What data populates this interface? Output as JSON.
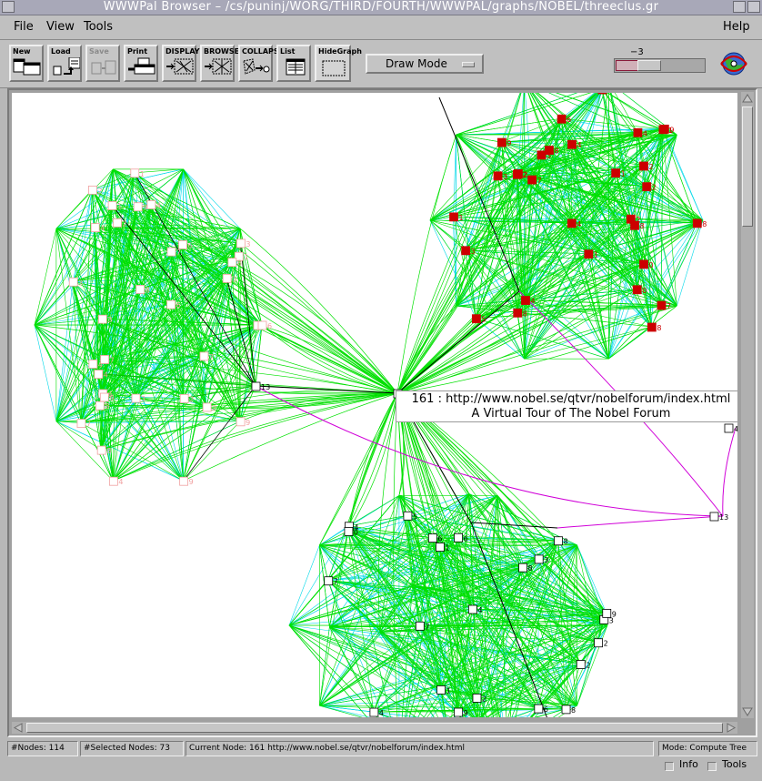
{
  "window": {
    "title": "WWWPal Browser – /cs/puninj/WORG/THIRD/FOURTH/WWWPAL/graphs/NOBEL/threeclus.gr"
  },
  "menu": {
    "file": "File",
    "view": "View",
    "tools": "Tools",
    "help": "Help"
  },
  "toolbar": {
    "new": "New",
    "load": "Load",
    "save": "Save",
    "print": "Print",
    "display": "DISPLAY",
    "browse": "BROWSE",
    "collapse": "COLLAPSE",
    "list": "List",
    "hide_graph": "HideGraph"
  },
  "mode_dropdown": {
    "value": "Draw Mode"
  },
  "zoom": {
    "value": "−3",
    "level_fraction": 0.25
  },
  "tooltip": {
    "line1": "161 : http://www.nobel.se/qtvr/nobelforum/index.html",
    "line2": "A Virtual Tour of The Nobel Forum"
  },
  "status": {
    "nodes": "#Nodes:  114",
    "selected": "#Selected Nodes:  73",
    "current": "Current Node: 161 http://www.nobel.se/qtvr/nobelforum/index.html",
    "mode": "Mode: Compute Tree"
  },
  "bottom": {
    "info": "Info",
    "tools": "Tools"
  },
  "colors": {
    "edge_green": "#00e000",
    "edge_cyan": "#00d8e8",
    "edge_magenta": "#d000d8",
    "node_red": "#cc0000",
    "node_pink": "#f0a0a0",
    "node_white": "#ffffff"
  },
  "graph_labels": {
    "hub": "161",
    "left_hub": "13",
    "right_node_a": "4",
    "right_node_b": "13",
    "left_cluster": [
      "8",
      "3",
      "9",
      "8",
      "4",
      "1",
      "7",
      "7",
      "8",
      "2",
      "1",
      "2",
      "8",
      "4",
      "3",
      "6",
      "6",
      "2",
      "4",
      "3",
      "1",
      "7",
      "3",
      "7",
      "6",
      "9",
      "2",
      "3",
      "4",
      "8",
      "6",
      "9",
      "9",
      "4"
    ],
    "top_cluster": [
      "8",
      "2",
      "2",
      "4",
      "9",
      "1",
      "2",
      "8",
      "3",
      "4",
      "6",
      "7",
      "0",
      "1",
      "2",
      "7",
      "3",
      "8",
      "1",
      "9",
      "4",
      "8",
      "4",
      "2",
      "6",
      "3",
      "1",
      "5",
      "0",
      "8"
    ],
    "bottom_cluster": [
      "4",
      "2",
      "3",
      "7",
      "1",
      "3",
      "2",
      "5",
      "7",
      "8",
      "6",
      "4",
      "8",
      "3",
      "6",
      "4",
      "8",
      "9",
      "3",
      "4",
      "1",
      "6",
      "2",
      "9",
      "0"
    ]
  }
}
